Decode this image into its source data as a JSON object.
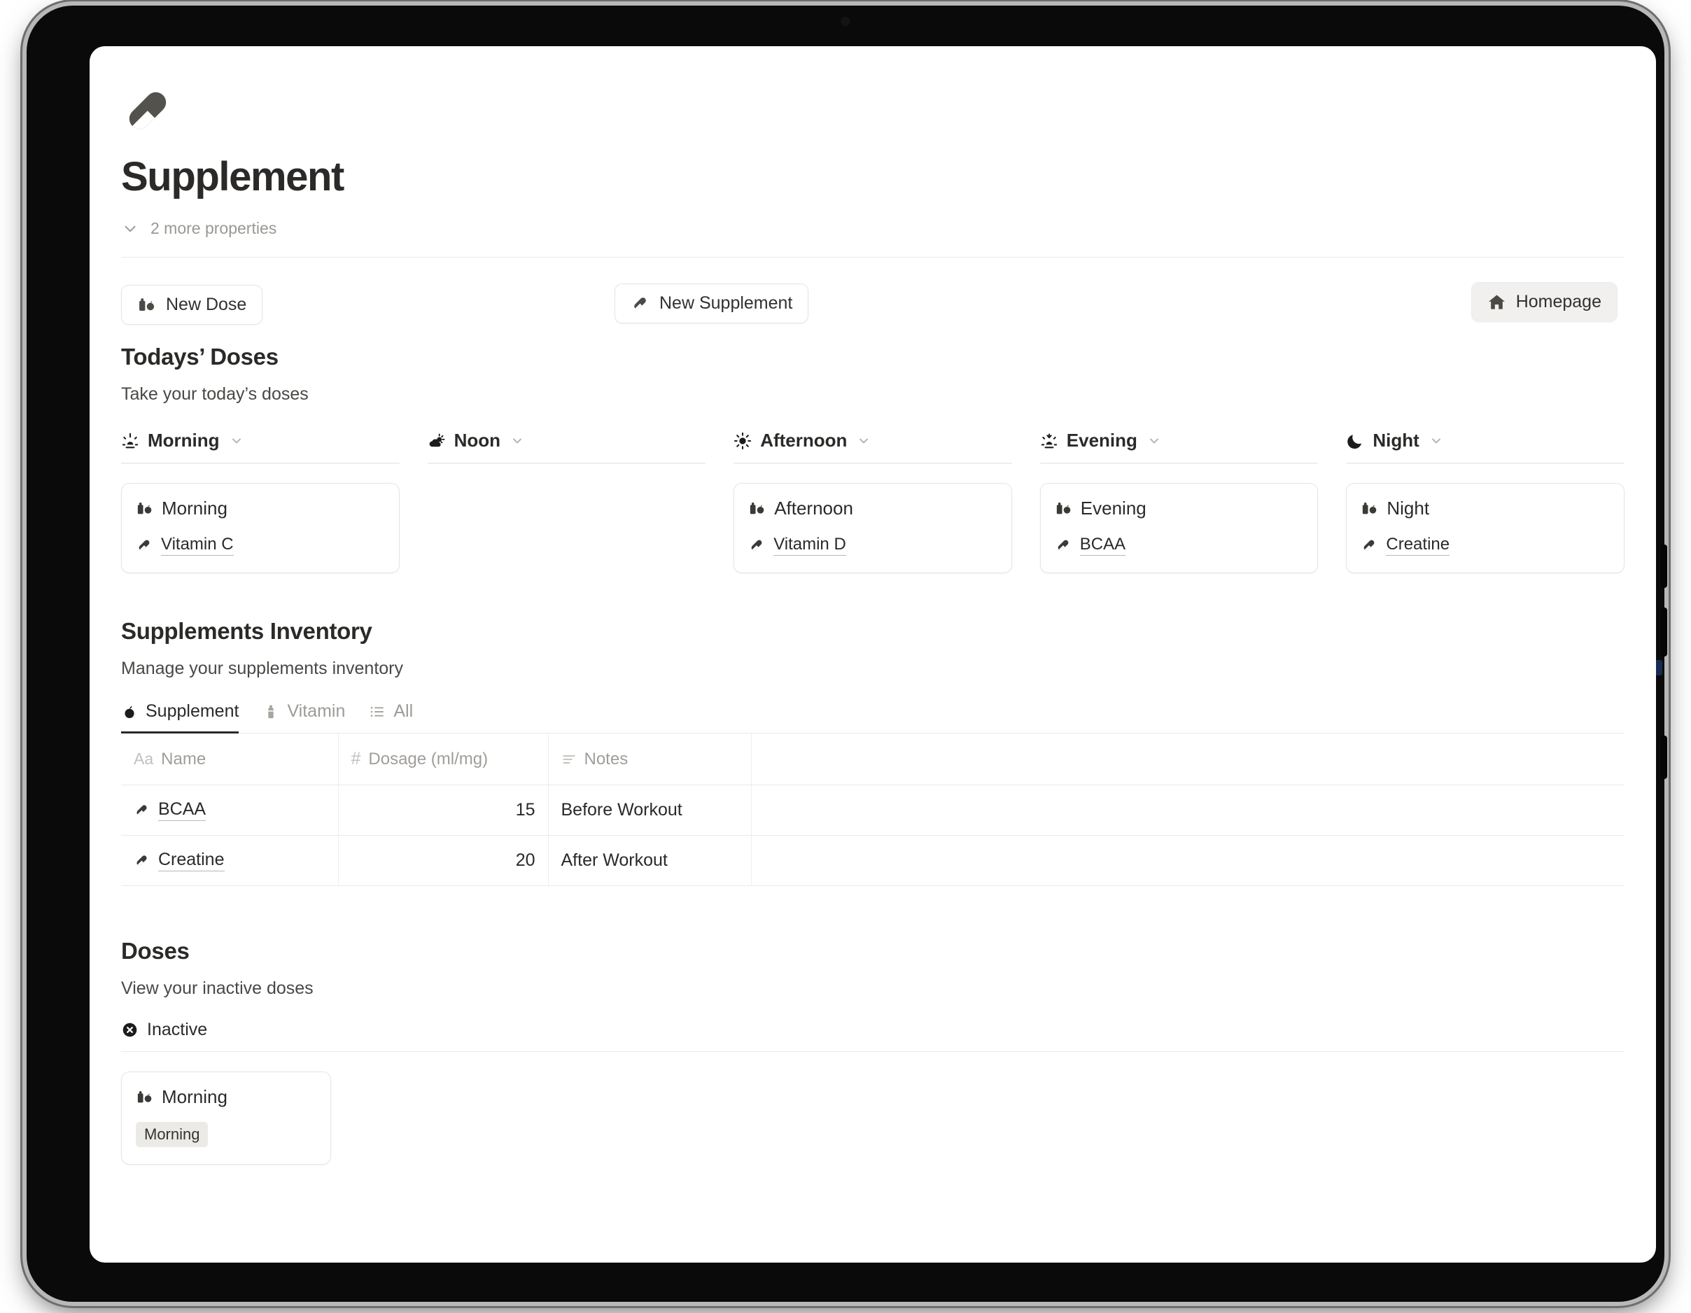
{
  "page": {
    "icon": "pill-icon",
    "title": "Supplement",
    "properties_label": "2 more properties"
  },
  "toolbar": {
    "new_dose_label": "New Dose",
    "new_dose_icon": "bottle-apple-icon",
    "new_supplement_label": "New Supplement",
    "new_supplement_icon": "pill-icon",
    "homepage_label": "Homepage",
    "homepage_icon": "home-icon",
    "homepage_bg": "#f1f0ee"
  },
  "todays_doses": {
    "title": "Todays’ Doses",
    "subtitle": "Take your today’s doses",
    "columns": [
      {
        "label": "Morning",
        "icon": "sunrise-icon",
        "chevron": "chevron-down-icon",
        "cards": [
          {
            "title": "Morning",
            "icon": "bottle-apple-icon",
            "items": [
              {
                "label": "Vitamin C",
                "icon": "pill-icon"
              }
            ]
          }
        ]
      },
      {
        "label": "Noon",
        "icon": "sun-cloud-icon",
        "chevron": "chevron-down-icon",
        "cards": []
      },
      {
        "label": "Afternoon",
        "icon": "sun-icon",
        "chevron": "chevron-down-icon",
        "cards": [
          {
            "title": "Afternoon",
            "icon": "bottle-apple-icon",
            "items": [
              {
                "label": "Vitamin D",
                "icon": "pill-icon"
              }
            ]
          }
        ]
      },
      {
        "label": "Evening",
        "icon": "sunset-icon",
        "chevron": "chevron-down-icon",
        "cards": [
          {
            "title": "Evening",
            "icon": "bottle-apple-icon",
            "items": [
              {
                "label": "BCAA",
                "icon": "pill-icon"
              }
            ]
          }
        ]
      },
      {
        "label": "Night",
        "icon": "moon-icon",
        "chevron": "chevron-down-icon",
        "cards": [
          {
            "title": "Night",
            "icon": "bottle-apple-icon",
            "items": [
              {
                "label": "Creatine",
                "icon": "pill-icon"
              }
            ]
          }
        ]
      }
    ]
  },
  "inventory": {
    "title": "Supplements Inventory",
    "subtitle": "Manage your supplements inventory",
    "tabs": [
      {
        "label": "Supplement",
        "icon": "apple-icon",
        "active": true
      },
      {
        "label": "Vitamin",
        "icon": "bottle-icon",
        "active": false
      },
      {
        "label": "All",
        "icon": "list-icon",
        "active": false
      }
    ],
    "table": {
      "headers": [
        {
          "label": "Name",
          "icon": "text-type-icon",
          "glyph": "Aa"
        },
        {
          "label": "Dosage (ml/mg)",
          "icon": "number-type-icon",
          "glyph": "#"
        },
        {
          "label": "Notes",
          "icon": "text-lines-icon",
          "glyph": "≡"
        }
      ],
      "rows": [
        {
          "name": "BCAA",
          "name_icon": "pill-icon",
          "dosage": "15",
          "notes": "Before Workout"
        },
        {
          "name": "Creatine",
          "name_icon": "pill-icon",
          "dosage": "20",
          "notes": "After Workout"
        }
      ]
    }
  },
  "doses": {
    "title": "Doses",
    "subtitle": "View your inactive doses",
    "filter_label": "Inactive",
    "filter_icon": "x-circle-icon",
    "cards": [
      {
        "title": "Morning",
        "icon": "bottle-apple-icon",
        "tag": "Morning"
      }
    ]
  }
}
